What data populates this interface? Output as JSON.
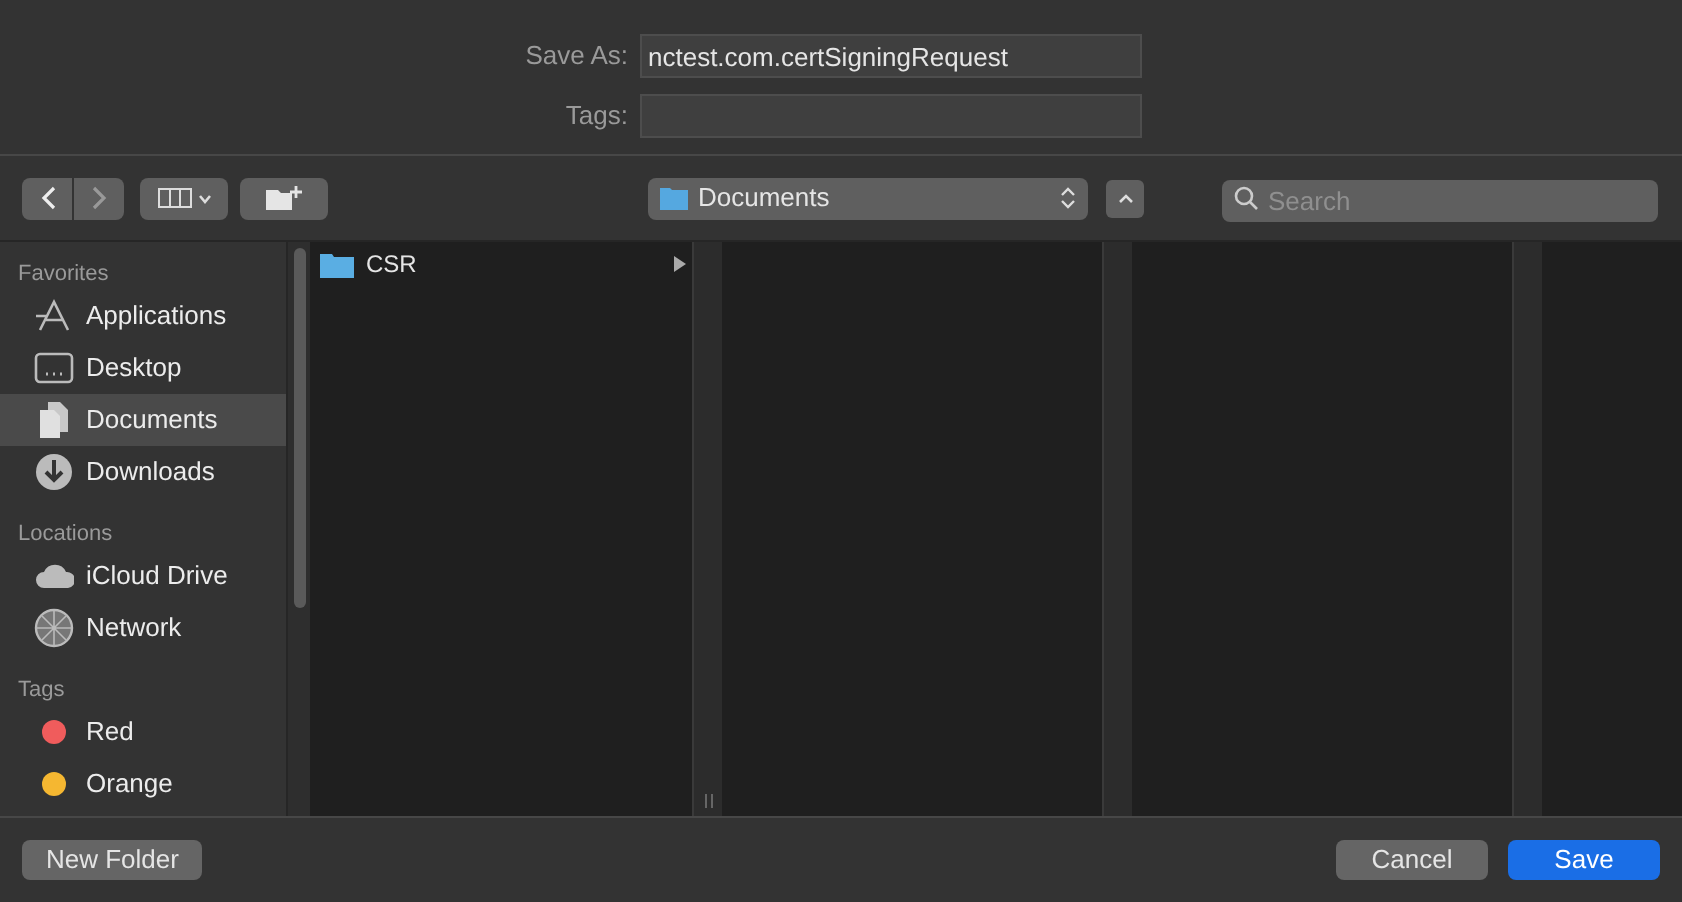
{
  "save_as": {
    "label": "Save As:",
    "value": "nctest.com.certSigningRequest"
  },
  "tags_field": {
    "label": "Tags:"
  },
  "toolbar": {
    "back_disabled": false,
    "forward_disabled": true,
    "location": "Documents",
    "search": {
      "placeholder": "Search"
    }
  },
  "sidebar": [
    {
      "heading": "Favorites",
      "items": [
        {
          "label": "Applications",
          "kind": "apps",
          "selected": false
        },
        {
          "label": "Desktop",
          "kind": "desktop",
          "selected": false
        },
        {
          "label": "Documents",
          "kind": "documents",
          "selected": true
        },
        {
          "label": "Downloads",
          "kind": "downloads",
          "selected": false
        }
      ]
    },
    {
      "heading": "Locations",
      "items": [
        {
          "label": "iCloud Drive",
          "kind": "cloud",
          "selected": false
        },
        {
          "label": "Network",
          "kind": "network",
          "selected": false
        }
      ]
    },
    {
      "heading": "Tags",
      "items": [
        {
          "label": "Red",
          "kind": "tag",
          "color": "#f05c5c",
          "selected": false
        },
        {
          "label": "Orange",
          "kind": "tag",
          "color": "#f5b731",
          "selected": false
        }
      ]
    }
  ],
  "columns": [
    {
      "items": [
        {
          "name": "CSR",
          "kind": "folder"
        }
      ]
    }
  ],
  "buttons": {
    "new_folder": "New Folder",
    "cancel": "Cancel",
    "save": "Save"
  }
}
